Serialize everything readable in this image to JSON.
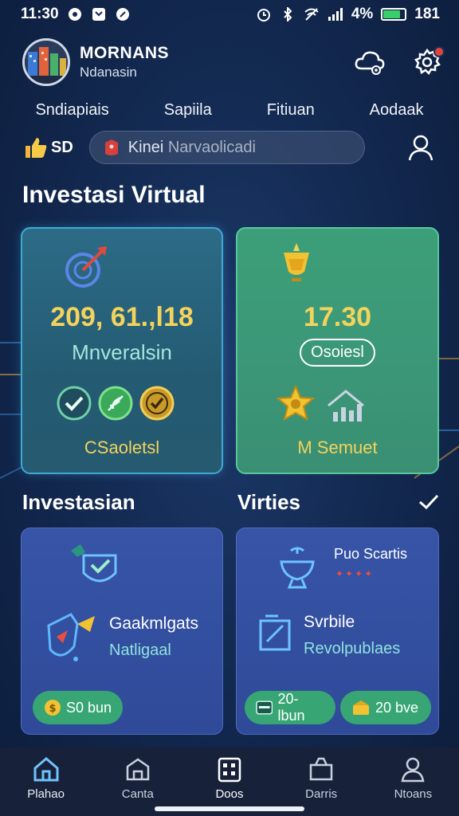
{
  "status_bar": {
    "time": "11:30",
    "battery_percent": "4%",
    "signal_text": "181"
  },
  "profile": {
    "name": "MORNANS",
    "subtitle": "Ndanasin"
  },
  "top_nav": {
    "items": [
      "Sndiapiais",
      "Sapiila",
      "Fitiuan",
      "Aodaak"
    ]
  },
  "search": {
    "badge": "SD",
    "text_primary": "Kinei",
    "text_secondary": "Narvaolicadi"
  },
  "section_main": {
    "title": "Investasi Virtual"
  },
  "card_blue": {
    "value": "209, 61.,l18",
    "label": "Mnveralsin",
    "footer": "CSaoletsl"
  },
  "card_green": {
    "value": "17.30",
    "pill": "Osoiesl",
    "footer": "M Semuet"
  },
  "sub_left": {
    "title": "Investasian"
  },
  "sub_right": {
    "title": "Virties"
  },
  "card_p1": {
    "title": "Gaakmlgats",
    "subtitle": "Natligaal",
    "pill": "S0 bun"
  },
  "card_p2": {
    "badge_title": "Puo Scartis",
    "title": "Svrbile",
    "subtitle": "Revolpublaes",
    "pill_left": "20-lbun",
    "pill_right": "20 bve"
  },
  "bottom_nav": [
    {
      "label": "Plahao",
      "icon": "home-icon"
    },
    {
      "label": "Canta",
      "icon": "house-outline-icon"
    },
    {
      "label": "Doos",
      "icon": "grid-doc-icon"
    },
    {
      "label": "Darris",
      "icon": "briefcase-icon"
    },
    {
      "label": "Ntoans",
      "icon": "user-icon"
    }
  ],
  "colors": {
    "accent_gold": "#f3d35c",
    "accent_teal": "#8fe3df",
    "pill_green": "#38a674",
    "card_blue": "#2c6b86",
    "card_green": "#3c9f79",
    "card_purple": "#3754a7"
  }
}
